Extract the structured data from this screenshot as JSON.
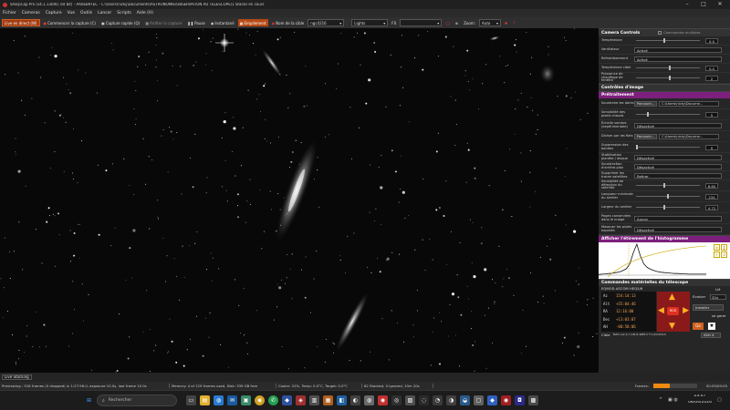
{
  "window": {
    "title": "SharpCap Pro (v4.1.13000, 64 bit) - AA0EB9TEC - C:\\Users\\nicky\\Documents\\ASTRONOMIE\\OBSERVATION AU TELESCOPE\\1 Stacks en cours"
  },
  "menu": [
    "Fichier",
    "Cameras",
    "Capture",
    "Vue",
    "Outils",
    "Lancer",
    "Scripts",
    "Aide (H)"
  ],
  "toolbar": {
    "live": "Live en direct (W)",
    "start_capture": "Commencer la capture (C)",
    "quick_capture": "Capture rapide (Q)",
    "stop_capture": "Arrêter la capture",
    "pause": "Pause",
    "snapshot": "Instantané",
    "stacking": "Empilement",
    "target_label": "Nom de la cible",
    "target_value": "ngc4216",
    "frame_type": "Lights",
    "fx_label": "FX",
    "zoom_label": "Zoom:",
    "zoom_value": "Auto"
  },
  "panel": {
    "camera_controls": {
      "title": "Camera Controls",
      "option": "Commandes multiples",
      "temperature_label": "Température",
      "temperature_value": "0.0",
      "ventilateur_label": "Ventilateur",
      "ventilateur_value": "Activé",
      "refroid_label": "Refroidissement",
      "refroid_value": "Activé",
      "target_temp_label": "Température cible",
      "target_temp_value": "0.0",
      "heater_label": "Puissance de chauffage de fenêtre",
      "heater_value": "2"
    },
    "image_controls_title": "Contrôles d'image",
    "preprocessing": {
      "title": "Prétraitement",
      "darks_label": "Soustraire les darks",
      "browse": "Parcourir...",
      "darks_path": "C:\\Users\\nicky\\Docume...",
      "hot_pixels_label": "Sensibilité des pixels chauds",
      "hot_pixels_value": "5",
      "dark_scale_label": "Échelle sombre (expérimentale)",
      "dark_scale_value": "Désactivé",
      "flats_label": "Diviser par les flats",
      "flats_path": "C:\\Users\\nicky\\Docume...",
      "bands_label": "Suppression des bandes",
      "bands_value": "0",
      "planetary_label": "Stabilisation planète / disque",
      "planetary_value": "Désactivé",
      "background_label": "Soustraction d'arrière-plan",
      "background_value": "Désactivé",
      "satellite_label": "Supprimer les traces satellites",
      "satellite_value": "Retirer",
      "sensitivity_label": "Sensibilité de détection du satellite",
      "sensitivity_value": "8.60",
      "min_length_label": "Longueur minimale du sentier",
      "min_length_value": "234",
      "width_label": "Largeur du sentier",
      "width_value": "4.72",
      "pages_label": "Pages conservées dans le nuage",
      "pages_value": "Aucun",
      "mask_label": "Masquer les pixels exposés",
      "mask_value": "Désactivé"
    },
    "histogram_title": "Afficher l'étirement de l'histogramme",
    "histogram_curve": [
      2,
      3,
      4,
      5,
      6,
      8,
      10,
      14,
      20,
      36,
      70,
      96,
      60,
      35,
      24,
      18,
      14,
      11,
      9,
      8,
      7,
      6,
      5,
      5,
      4,
      4,
      3,
      3,
      3,
      3,
      3,
      3
    ],
    "telescope": {
      "title": "Commandes matérielles du télescope",
      "mount": "EQMOD ASCOM HEQ5/6",
      "az_label": "Az",
      "az_value": "154:14:13",
      "alt_label": "Alt",
      "alt_value": "+55:04:46",
      "ra_label": "RA",
      "ra_value": "12:16:00",
      "dec_label": "Dec",
      "dec_value": "+13:03:07",
      "ah_label": "AH",
      "ah_value": "-00:58:06",
      "evaluer": "Évaluer",
      "rate": "32x",
      "installer": "Installer",
      "parking": "se garer",
      "go": "Go",
      "target_label": "Cible",
      "target_coords": "RA=12:17:16.4 Dec=+13:00:03",
      "goto": "Aller à",
      "link_label": "Lié"
    }
  },
  "live_stacking_label": "Live Stacking",
  "status": {
    "previewing": "Previewing : 518 frames (0 dropped) in 1:27:56.0, exposure 10.0s, last frame 10.0s",
    "memory": "Memory: 4 of 129 frames used, Disk: 339 GB free",
    "cooler": "Cooler: 22%, Temp: 0.0°C, Target: 0.0°C",
    "stacked": "62 Stacked, 0 Ignored, 10m 20s",
    "frames_label": "Frames:",
    "frames_count": "00:05/00:05",
    "frames_progress": 0.38
  },
  "taskbar": {
    "search_placeholder": "Rechercher",
    "time": "23:47",
    "date": "08/04/2026"
  },
  "colors": {
    "accent_purple": "#7d1f7d",
    "accent_orange": "#e07010",
    "live_red": "#a03a10"
  }
}
